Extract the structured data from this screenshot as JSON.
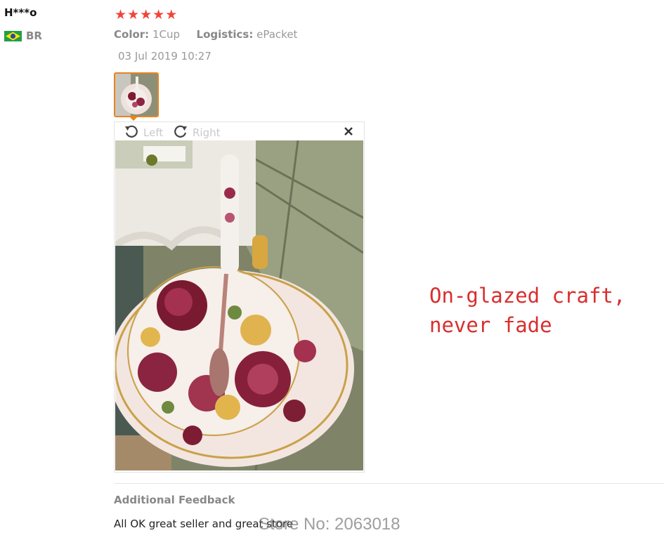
{
  "review": {
    "username": "H***o",
    "country_code": "BR",
    "rating_stars": 5,
    "color_label": "Color:",
    "color_value": "1Cup",
    "logistics_label": "Logistics:",
    "logistics_value": "ePacket",
    "date": "03 Jul 2019 10:27"
  },
  "viewer": {
    "rotate_left_label": "Left",
    "rotate_right_label": "Right"
  },
  "overlay": {
    "text": "On-glazed craft,\nnever fade"
  },
  "feedback": {
    "title": "Additional Feedback",
    "text": "All OK great seller and great store"
  },
  "watermark": "Store No: 2063018",
  "colors": {
    "star": "#f0453a",
    "thumb_border": "#e8831e",
    "overlay_text": "#d92e2e"
  }
}
